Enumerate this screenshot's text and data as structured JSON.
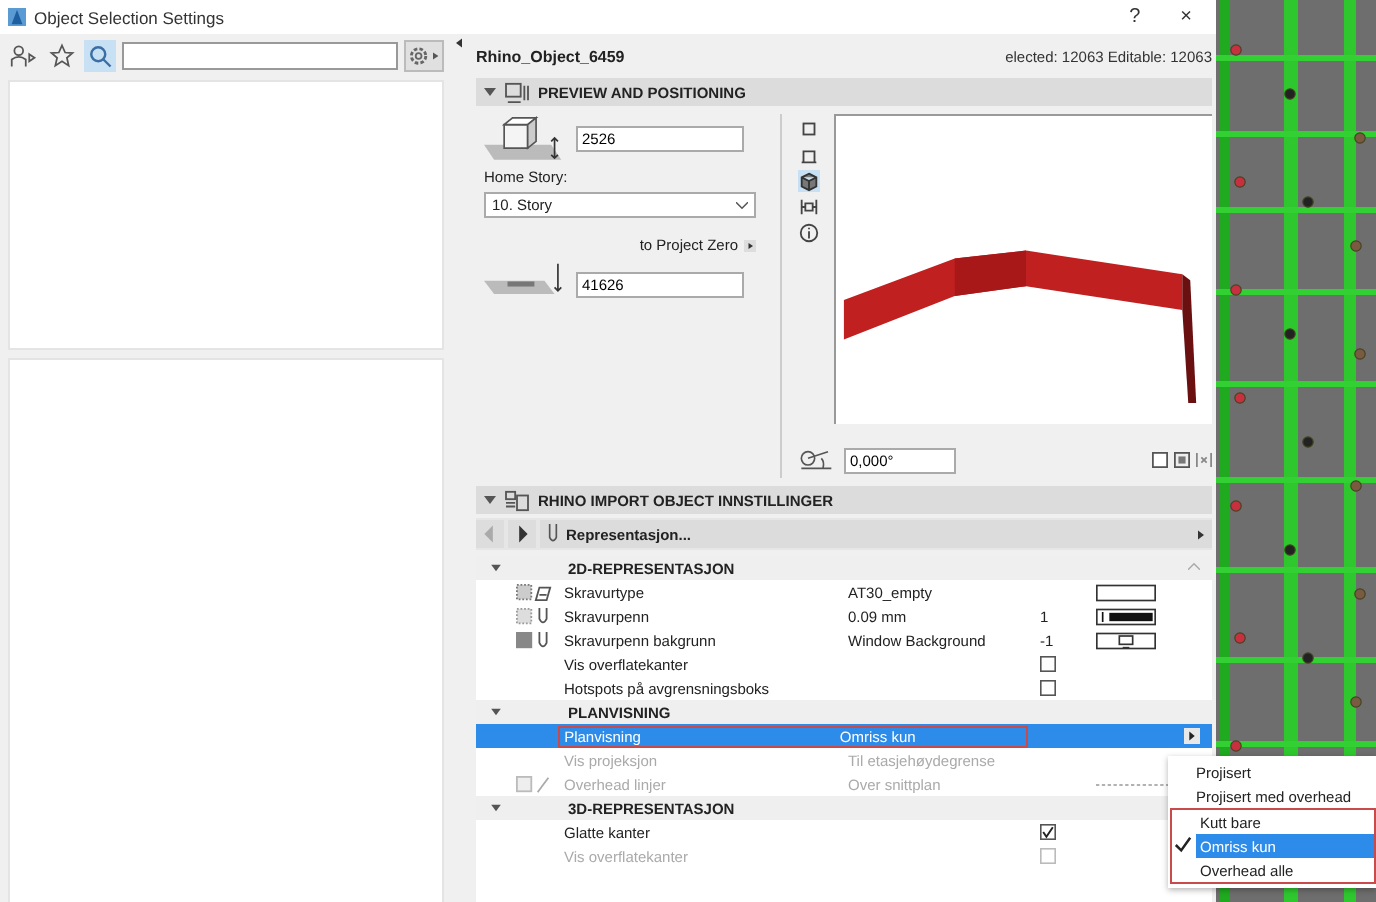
{
  "window": {
    "title": "Object Selection Settings",
    "buttons": [
      "?",
      "×"
    ]
  },
  "library": {
    "tools": [
      {
        "kind": "people",
        "selected": false
      },
      {
        "kind": "star",
        "selected": false
      },
      {
        "kind": "search",
        "selected": true
      }
    ]
  },
  "header": {
    "name": "Rhino_Object_6459",
    "selection_info": "elected: 12063 Editable: 12063"
  },
  "preview_section": {
    "title": "PREVIEW AND POSITIONING",
    "expanded": true,
    "height_value": "2526",
    "home_story_label": "Home Story:",
    "home_story": "10. Story",
    "reference_label": "to Project Zero",
    "elevation_value": "41626",
    "angle_value": "0,000°",
    "view_modes": [
      {
        "kind": "plan",
        "selected": false
      },
      {
        "kind": "section",
        "selected": false
      },
      {
        "kind": "cube",
        "selected": true
      },
      {
        "kind": "frame",
        "selected": false
      },
      {
        "kind": "info",
        "selected": false
      }
    ]
  },
  "parameter_section": {
    "title": "RHINO IMPORT OBJECT INNSTILLINGER",
    "expanded": true,
    "page": "Representasjon...",
    "rows": [
      {
        "kind": "group",
        "name": "2D-REPRESENTASJON",
        "expanded": true
      },
      {
        "kind": "fill",
        "name": "Skravurtype",
        "value": "AT30_empty",
        "selected": false,
        "disabled": false
      },
      {
        "kind": "pen",
        "name": "Skravurpenn",
        "value": "0.09 mm",
        "number": "1",
        "selected": false,
        "disabled": false
      },
      {
        "kind": "background",
        "name": "Skravurpenn bakgrunn",
        "value": "Window Background",
        "number": "-1",
        "selected": false,
        "disabled": false
      },
      {
        "kind": "check",
        "name": "Vis overflatekanter",
        "checked": false,
        "selected": false,
        "disabled": false
      },
      {
        "kind": "check",
        "name": "Hotspots på avgrensningsboks",
        "checked": false,
        "selected": false,
        "disabled": false
      },
      {
        "kind": "group",
        "name": "PLANVISNING",
        "expanded": true
      },
      {
        "kind": "menu",
        "name": "Planvisning",
        "value": "Omriss kun",
        "selected": true,
        "disabled": false
      },
      {
        "kind": "text",
        "name": "Vis projeksjon",
        "value": "Til etasjehøydegrense",
        "selected": false,
        "disabled": true
      },
      {
        "kind": "line",
        "name": "Overhead linjer",
        "value": "Over snittplan",
        "selected": false,
        "disabled": true
      },
      {
        "kind": "group",
        "name": "3D-REPRESENTASJON",
        "expanded": true
      },
      {
        "kind": "check",
        "name": "Glatte kanter",
        "checked": true,
        "selected": false,
        "disabled": false
      },
      {
        "kind": "check",
        "name": "Vis overflatekanter",
        "checked": false,
        "selected": false,
        "disabled": true
      }
    ]
  },
  "popup_menu": {
    "items": [
      {
        "label": "Projisert",
        "selected": false
      },
      {
        "label": "Projisert med overhead",
        "selected": false
      },
      {
        "label": "Kutt bare",
        "selected": false
      },
      {
        "label": "Omriss kun",
        "selected": true
      },
      {
        "label": "Overhead alle",
        "selected": false
      }
    ]
  }
}
